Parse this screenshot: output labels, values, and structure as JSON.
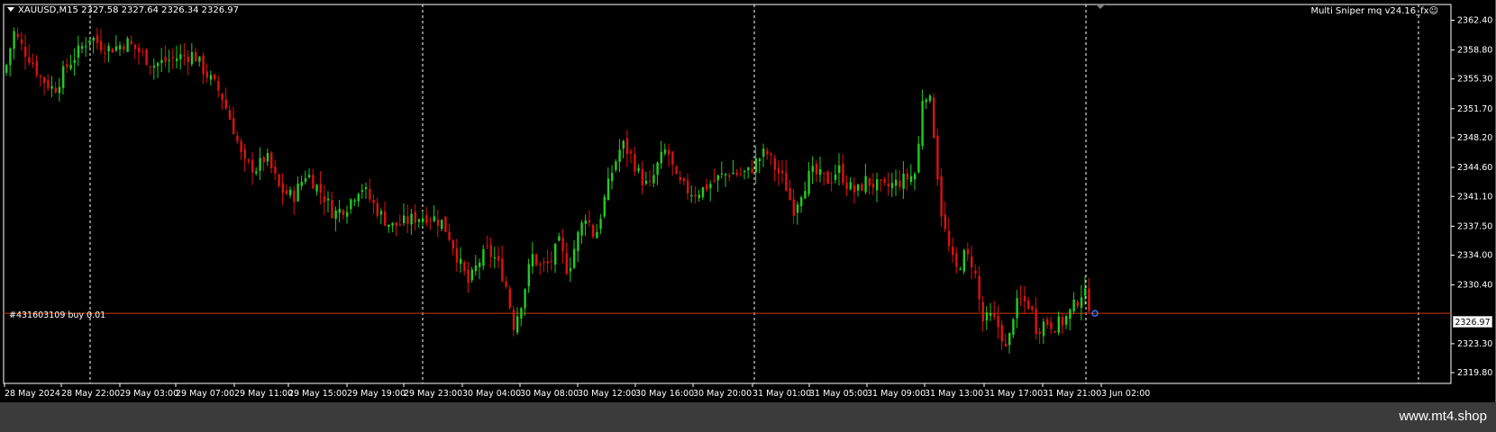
{
  "chart": {
    "symbol_header": "XAUUSD,M15  2327.58 2327.64 2326.34 2326.97",
    "indicator_label": "Multi Sniper mq v24.16_fx☺",
    "order_label": "#431603109 buy 0.01",
    "current_price": "2326.97",
    "colors": {
      "background": "#000000",
      "bull": "#22cc22",
      "bear": "#dd1111",
      "grid": "#ffffff",
      "order_line": "#cc3b00"
    }
  },
  "watermark": "www.mt4.shop",
  "chart_data": {
    "type": "candlestick",
    "title": "XAUUSD,M15",
    "ylim": [
      2318.5,
      2364.3
    ],
    "y_ticks": [
      "2362.40",
      "2358.80",
      "2355.30",
      "2351.70",
      "2348.20",
      "2344.60",
      "2341.10",
      "2337.50",
      "2334.00",
      "2330.40",
      "2323.30",
      "2319.80"
    ],
    "x_ticks": [
      "28 May 2024",
      "28 May 22:00",
      "29 May 03:00",
      "29 May 07:00",
      "29 May 11:00",
      "29 May 15:00",
      "29 May 19:00",
      "29 May 23:00",
      "30 May 04:00",
      "30 May 08:00",
      "30 May 12:00",
      "30 May 16:00",
      "30 May 20:00",
      "31 May 01:00",
      "31 May 05:00",
      "31 May 09:00",
      "31 May 13:00",
      "31 May 17:00",
      "31 May 21:00",
      "3 Jun 02:00"
    ],
    "day_separators": [
      "28 May 22:00",
      "29 May 23:00",
      "31 May 01:00",
      "31 May 21:00"
    ],
    "order_price": 2326.97,
    "close_path": [
      [
        0,
        2356.0
      ],
      [
        10,
        2361.0
      ],
      [
        20,
        2359.0
      ],
      [
        30,
        2357.5
      ],
      [
        40,
        2355.5
      ],
      [
        55,
        2354.0
      ],
      [
        70,
        2357.0
      ],
      [
        85,
        2359.0
      ],
      [
        95,
        2360.5
      ],
      [
        105,
        2359.5
      ],
      [
        115,
        2359.0
      ],
      [
        125,
        2359.2
      ],
      [
        135,
        2359.8
      ],
      [
        150,
        2358.5
      ],
      [
        165,
        2357.0
      ],
      [
        180,
        2357.5
      ],
      [
        195,
        2358.0
      ],
      [
        210,
        2358.3
      ],
      [
        220,
        2356.5
      ],
      [
        230,
        2355.0
      ],
      [
        240,
        2353.5
      ],
      [
        255,
        2349.0
      ],
      [
        265,
        2345.0
      ],
      [
        280,
        2344.5
      ],
      [
        290,
        2346.0
      ],
      [
        305,
        2342.0
      ],
      [
        320,
        2341.0
      ],
      [
        335,
        2344.0
      ],
      [
        345,
        2342.5
      ],
      [
        355,
        2341.0
      ],
      [
        365,
        2339.0
      ],
      [
        380,
        2340.0
      ],
      [
        395,
        2342.5
      ],
      [
        410,
        2340.0
      ],
      [
        420,
        2338.5
      ],
      [
        430,
        2337.5
      ],
      [
        440,
        2337.8
      ],
      [
        455,
        2338.5
      ],
      [
        470,
        2338.8
      ],
      [
        485,
        2338.0
      ],
      [
        495,
        2336.0
      ],
      [
        505,
        2333.0
      ],
      [
        515,
        2330.5
      ],
      [
        525,
        2333.0
      ],
      [
        535,
        2334.5
      ],
      [
        545,
        2333.5
      ],
      [
        555,
        2331.0
      ],
      [
        565,
        2325.5
      ],
      [
        575,
        2329.0
      ],
      [
        585,
        2334.0
      ],
      [
        595,
        2332.5
      ],
      [
        605,
        2333.0
      ],
      [
        615,
        2335.5
      ],
      [
        625,
        2332.0
      ],
      [
        635,
        2336.0
      ],
      [
        645,
        2339.0
      ],
      [
        655,
        2336.0
      ],
      [
        665,
        2340.5
      ],
      [
        675,
        2344.5
      ],
      [
        685,
        2347.5
      ],
      [
        695,
        2346.0
      ],
      [
        705,
        2343.5
      ],
      [
        715,
        2342.0
      ],
      [
        725,
        2345.0
      ],
      [
        735,
        2347.0
      ],
      [
        745,
        2343.0
      ],
      [
        755,
        2342.0
      ],
      [
        765,
        2341.5
      ],
      [
        775,
        2342.0
      ],
      [
        785,
        2342.8
      ],
      [
        795,
        2343.5
      ],
      [
        805,
        2344.0
      ],
      [
        815,
        2343.8
      ],
      [
        825,
        2344.0
      ],
      [
        835,
        2345.5
      ],
      [
        845,
        2346.5
      ],
      [
        855,
        2344.5
      ],
      [
        865,
        2343.0
      ],
      [
        875,
        2339.5
      ],
      [
        885,
        2342.0
      ],
      [
        895,
        2344.0
      ],
      [
        905,
        2343.5
      ],
      [
        915,
        2343.0
      ],
      [
        925,
        2344.5
      ],
      [
        935,
        2342.5
      ],
      [
        945,
        2341.5
      ],
      [
        955,
        2343.0
      ],
      [
        965,
        2342.5
      ],
      [
        975,
        2342.0
      ],
      [
        985,
        2342.5
      ],
      [
        995,
        2343.0
      ],
      [
        1005,
        2343.5
      ],
      [
        1012,
        2344.0
      ],
      [
        1018,
        2353.0
      ],
      [
        1025,
        2354.0
      ],
      [
        1032,
        2348.0
      ],
      [
        1038,
        2340.0
      ],
      [
        1045,
        2336.0
      ],
      [
        1055,
        2332.0
      ],
      [
        1065,
        2334.0
      ],
      [
        1075,
        2333.0
      ],
      [
        1085,
        2326.0
      ],
      [
        1095,
        2326.5
      ],
      [
        1105,
        2325.0
      ],
      [
        1112,
        2322.0
      ],
      [
        1120,
        2327.5
      ],
      [
        1128,
        2328.5
      ],
      [
        1138,
        2328.0
      ],
      [
        1145,
        2325.0
      ],
      [
        1155,
        2326.0
      ],
      [
        1165,
        2325.5
      ],
      [
        1175,
        2326.0
      ],
      [
        1185,
        2327.5
      ],
      [
        1195,
        2329.5
      ],
      [
        1200,
        2329.0
      ],
      [
        1207,
        2327.0
      ]
    ]
  }
}
